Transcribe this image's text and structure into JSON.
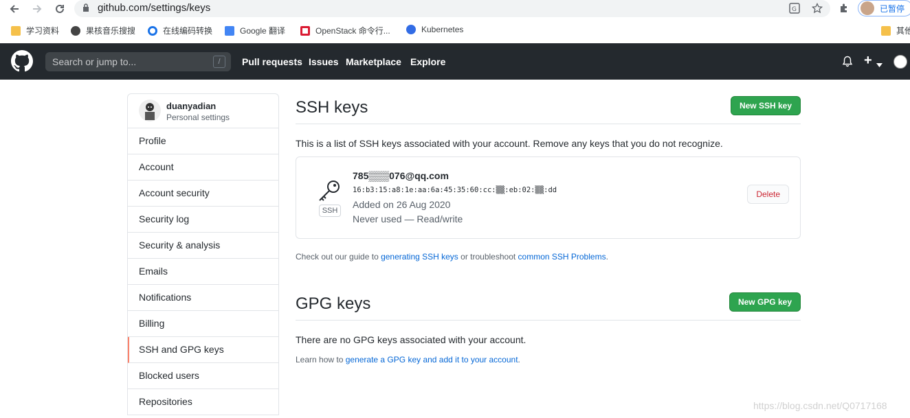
{
  "browser": {
    "url": "github.com/settings/keys",
    "profile_label": "已暂停",
    "bookmarks": [
      "学习资料",
      "果核音乐搜搜",
      "在线编码转换",
      "Google 翻译",
      "OpenStack 命令行...",
      "Kubernetes"
    ],
    "other_bookmarks": "其他"
  },
  "header": {
    "search_placeholder": "Search or jump to...",
    "slash_key": "/",
    "nav": [
      "Pull requests",
      "Issues",
      "Marketplace",
      "Explore"
    ],
    "plus": "+"
  },
  "sidebar": {
    "username": "duanyadian",
    "subtitle": "Personal settings",
    "items": [
      "Profile",
      "Account",
      "Account security",
      "Security log",
      "Security & analysis",
      "Emails",
      "Notifications",
      "Billing",
      "SSH and GPG keys",
      "Blocked users",
      "Repositories"
    ],
    "active_index": 8
  },
  "ssh": {
    "title": "SSH keys",
    "new_button": "New SSH key",
    "description": "This is a list of SSH keys associated with your account. Remove any keys that you do not recognize.",
    "key": {
      "title": "785▒▒▒076@qq.com",
      "fingerprint": "16:b3:15:a8:1e:aa:6a:45:35:60:cc:▒▒:eb:02:▒▒:dd",
      "badge": "SSH",
      "added": "Added on 26 Aug 2020",
      "usage": "Never used — Read/write",
      "delete_label": "Delete"
    },
    "guide_prefix": "Check out our guide to ",
    "guide_link1": "generating SSH keys",
    "guide_middle": " or troubleshoot ",
    "guide_link2": "common SSH Problems",
    "guide_suffix": "."
  },
  "gpg": {
    "title": "GPG keys",
    "new_button": "New GPG key",
    "empty": "There are no GPG keys associated with your account.",
    "learn_prefix": "Learn how to ",
    "learn_link": "generate a GPG key and add it to your account",
    "learn_suffix": "."
  },
  "watermark": "https://blog.csdn.net/Q0717168",
  "colors": {
    "header_bg": "#24292e",
    "green": "#2ea44f",
    "link": "#0366d6",
    "danger": "#cb2431",
    "active_border": "#f9826c"
  }
}
